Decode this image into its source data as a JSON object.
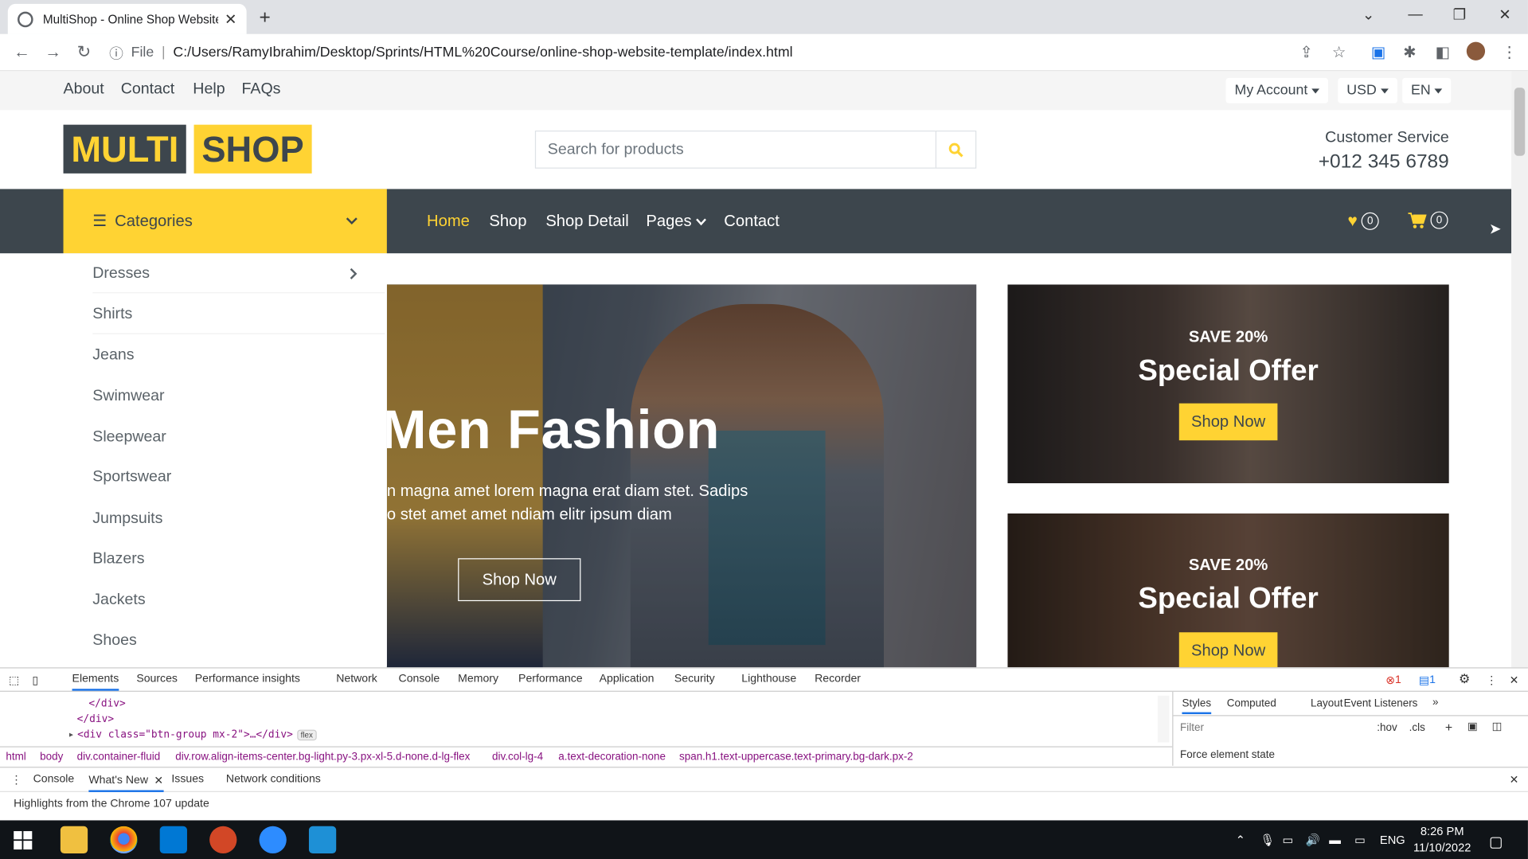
{
  "browser": {
    "tab_title": "MultiShop - Online Shop Website Template",
    "url_scheme": "File",
    "url": "C:/Users/RamyIbrahim/Desktop/Sprints/HTML%20Course/online-shop-website-template/index.html"
  },
  "topbar": {
    "links": [
      "About",
      "Contact",
      "Help",
      "FAQs"
    ],
    "account": "My Account",
    "currency": "USD",
    "language": "EN"
  },
  "header": {
    "logo_part1": "MULTI",
    "logo_part2": "SHOP",
    "search_placeholder": "Search for products",
    "customer_service_label": "Customer Service",
    "customer_service_phone": "+012 345 6789"
  },
  "navbar": {
    "categories_label": "Categories",
    "links": [
      "Home",
      "Shop",
      "Shop Detail",
      "Pages",
      "Contact"
    ],
    "wishlist_count": "0",
    "cart_count": "0"
  },
  "categories": [
    "Dresses",
    "Shirts",
    "Jeans",
    "Swimwear",
    "Sleepwear",
    "Sportswear",
    "Jumpsuits",
    "Blazers",
    "Jackets",
    "Shoes"
  ],
  "hero": {
    "title": "Men Fashion",
    "text_line1": "n magna amet lorem magna erat diam stet. Sadips",
    "text_line2": "o stet amet amet ndiam elitr ipsum diam",
    "button": "Shop Now"
  },
  "offers": [
    {
      "save": "SAVE 20%",
      "title": "Special Offer",
      "button": "Shop Now"
    },
    {
      "save": "SAVE 20%",
      "title": "Special Offer",
      "button": "Shop Now"
    }
  ],
  "devtools": {
    "tabs": [
      "Elements",
      "Sources",
      "Performance insights",
      "Network",
      "Console",
      "Memory",
      "Performance",
      "Application",
      "Security",
      "Lighthouse",
      "Recorder"
    ],
    "errors": "1",
    "messages": "1",
    "code_lines": [
      "</div>",
      "</div>",
      "<div class=\"btn-group mx-2\">…</div>"
    ],
    "flex_badge": "flex",
    "breadcrumbs": [
      "html",
      "body",
      "div.container-fluid",
      "div.row.align-items-center.bg-light.py-3.px-xl-5.d-none.d-lg-flex",
      "div.col-lg-4",
      "a.text-decoration-none",
      "span.h1.text-uppercase.text-primary.bg-dark.px-2"
    ],
    "style_tabs": [
      "Styles",
      "Computed",
      "Layout",
      "Event Listeners"
    ],
    "filter_placeholder": "Filter",
    "hov": ":hov",
    "cls": ".cls",
    "force_state": "Force element state",
    "drawer_tabs": [
      "Console",
      "What's New",
      "Issues",
      "Network conditions"
    ],
    "drawer_message": "Highlights from the Chrome 107 update"
  },
  "taskbar": {
    "language": "ENG",
    "time": "8:26 PM",
    "date": "11/10/2022"
  },
  "colors": {
    "primary": "#FFD333",
    "dark": "#3D464D",
    "light": "#F5F5F5"
  }
}
